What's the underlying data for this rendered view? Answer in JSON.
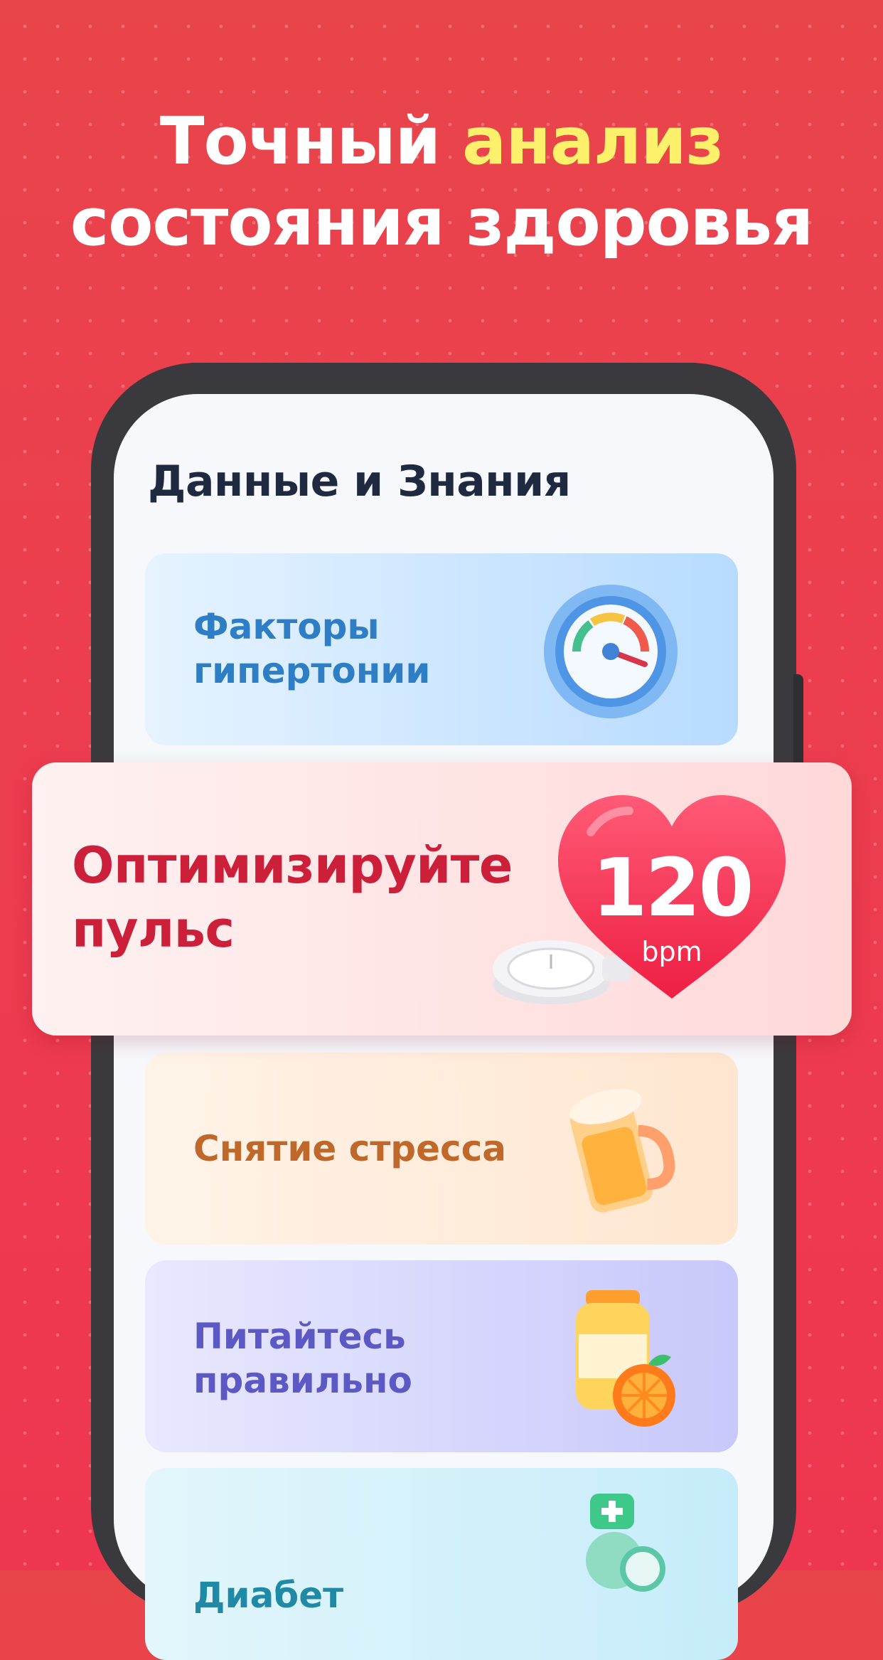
{
  "headline": {
    "line1_prefix": "Точный",
    "line1_accent": "анализ",
    "line2": "состояния здоровья"
  },
  "screen": {
    "title": "Данные и Знания",
    "cards": [
      {
        "line1": "Факторы",
        "line2": "гипертонии",
        "icon": "speedometer-icon"
      },
      {
        "line1": "Снятие стресса",
        "icon": "beer-mug-icon"
      },
      {
        "line1": "Питайтесь",
        "line2": "правильно",
        "icon": "jar-orange-icon"
      },
      {
        "line1": "Диабет",
        "icon": "doctor-icon"
      }
    ]
  },
  "pulse": {
    "line1": "Оптимизируйте",
    "line2": "пульс",
    "value": "120",
    "unit": "bpm",
    "icon": "heart-icon"
  },
  "colors": {
    "background": "#ec3d4f",
    "accent": "#fdf06a",
    "pulse_text": "#cc1f3a"
  }
}
